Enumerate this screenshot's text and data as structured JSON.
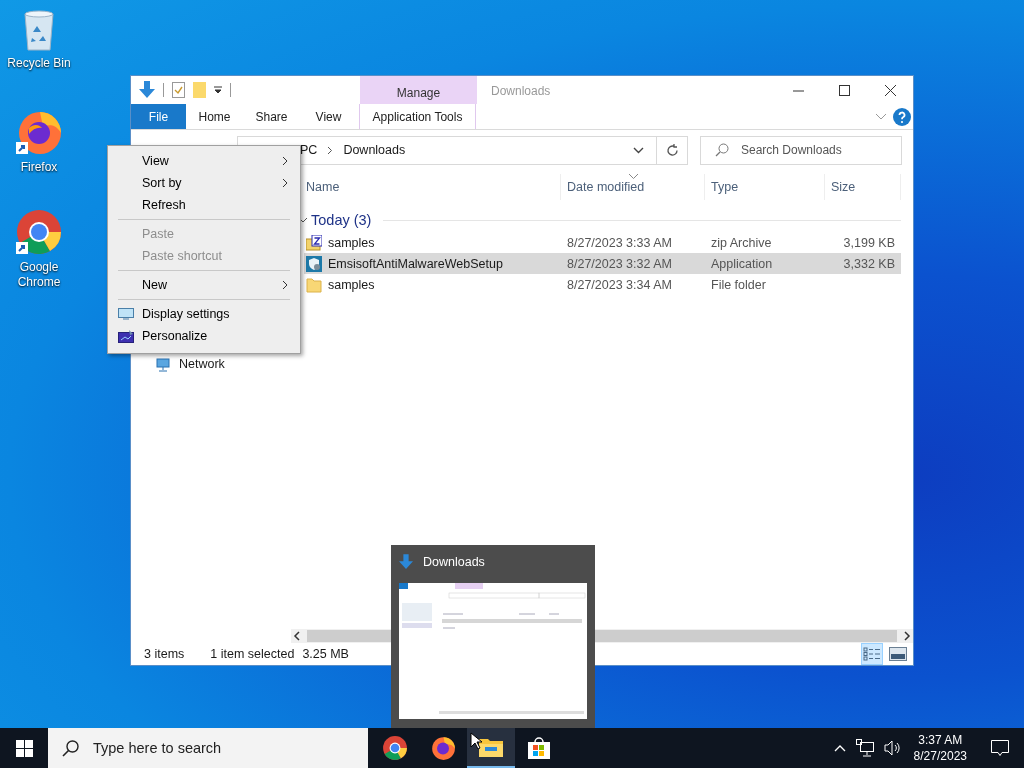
{
  "desktop_icons": [
    {
      "label": "Recycle Bin",
      "kind": "recycle-bin",
      "shortcut": false
    },
    {
      "label": "Firefox",
      "kind": "firefox",
      "shortcut": true
    },
    {
      "label": "Google Chrome",
      "kind": "chrome",
      "shortcut": true
    }
  ],
  "explorer": {
    "title": "Downloads",
    "context_group": "Manage",
    "tabs": [
      {
        "label": "File",
        "kind": "file"
      },
      {
        "label": "Home",
        "kind": "tab"
      },
      {
        "label": "Share",
        "kind": "tab"
      },
      {
        "label": "View",
        "kind": "tab"
      },
      {
        "label": "Application Tools",
        "kind": "context"
      }
    ],
    "address": [
      "PC",
      "Downloads"
    ],
    "search": {
      "placeholder": "Search Downloads"
    },
    "nav": [
      {
        "label": "Network"
      }
    ],
    "columns": [
      {
        "label": "Name",
        "sorted": false
      },
      {
        "label": "Date modified",
        "sorted": true
      },
      {
        "label": "Type",
        "sorted": false
      },
      {
        "label": "Size",
        "sorted": false
      }
    ],
    "group": {
      "label": "Today (3)",
      "expanded": true
    },
    "rows": [
      {
        "name": "samples",
        "date": "8/27/2023 3:33 AM",
        "type": "zip Archive",
        "size": "3,199 KB",
        "kind": "zip",
        "selected": false
      },
      {
        "name": "EmsisoftAntiMalwareWebSetup",
        "date": "8/27/2023 3:32 AM",
        "type": "Application",
        "size": "3,332 KB",
        "kind": "app",
        "selected": true
      },
      {
        "name": "samples",
        "date": "8/27/2023 3:34 AM",
        "type": "File folder",
        "size": "",
        "kind": "folder",
        "selected": false
      }
    ],
    "status": {
      "items": "3 items",
      "selection": "1 item selected",
      "size": "3.25 MB"
    },
    "views": [
      {
        "kind": "details",
        "selected": true
      },
      {
        "kind": "large-icons",
        "selected": false
      }
    ]
  },
  "context_menu": {
    "items": [
      {
        "kind": "item",
        "label": "View",
        "submenu": true,
        "disabled": false
      },
      {
        "kind": "item",
        "label": "Sort by",
        "submenu": true,
        "disabled": false
      },
      {
        "kind": "item",
        "label": "Refresh",
        "submenu": false,
        "disabled": false
      },
      {
        "kind": "separator"
      },
      {
        "kind": "item",
        "label": "Paste",
        "submenu": false,
        "disabled": true
      },
      {
        "kind": "item",
        "label": "Paste shortcut",
        "submenu": false,
        "disabled": true
      },
      {
        "kind": "separator"
      },
      {
        "kind": "item",
        "label": "New",
        "submenu": true,
        "disabled": false
      },
      {
        "kind": "separator"
      },
      {
        "kind": "display",
        "label": "Display settings",
        "submenu": false,
        "disabled": false
      },
      {
        "kind": "personalize",
        "label": "Personalize",
        "submenu": false,
        "disabled": false
      }
    ]
  },
  "thumbnail": {
    "title": "Downloads"
  },
  "taskbar": {
    "search": {
      "placeholder": "Type here to search"
    },
    "apps": [
      {
        "kind": "chrome",
        "active": false
      },
      {
        "kind": "firefox",
        "active": false
      },
      {
        "kind": "explorer",
        "active": true
      },
      {
        "kind": "store",
        "active": false
      }
    ],
    "time": "3:37 AM",
    "date": "8/27/2023"
  }
}
